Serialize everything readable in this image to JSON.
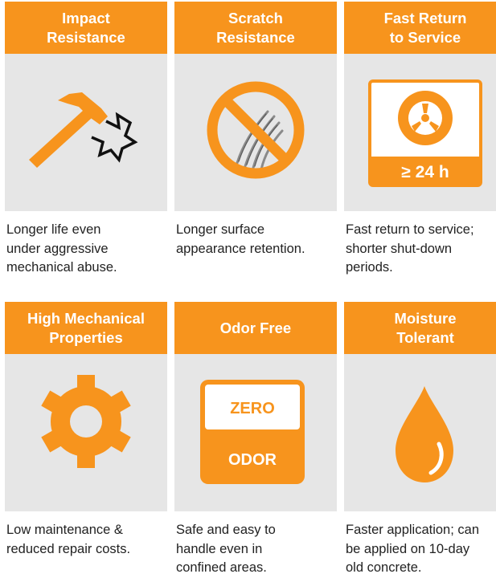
{
  "colors": {
    "accent": "#f7941d",
    "panel": "#e6e6e6",
    "text": "#222222"
  },
  "features": [
    {
      "title": "Impact\nResistance",
      "icon": "hammer-impact-icon",
      "description": "Longer life even\nunder aggressive\nmechanical abuse."
    },
    {
      "title": "Scratch\nResistance",
      "icon": "no-scratch-icon",
      "description": "Longer surface\nappearance retention."
    },
    {
      "title": "Fast Return\nto Service",
      "icon": "wheel-icon",
      "badge": "≥ 24 h",
      "description": "Fast return to service;\nshorter shut-down\nperiods."
    },
    {
      "title": "High Mechanical\nProperties",
      "icon": "gear-icon",
      "description": "Low maintenance &\nreduced repair costs."
    },
    {
      "title": "Odor Free",
      "icon": "zero-odor-icon",
      "badge_top": "ZERO",
      "badge_bottom": "ODOR",
      "description": "Safe and easy to\nhandle even in\nconfined areas."
    },
    {
      "title": "Moisture\nTolerant",
      "icon": "water-drop-icon",
      "description": "Faster application; can\nbe applied on 10-day\nold concrete."
    }
  ]
}
